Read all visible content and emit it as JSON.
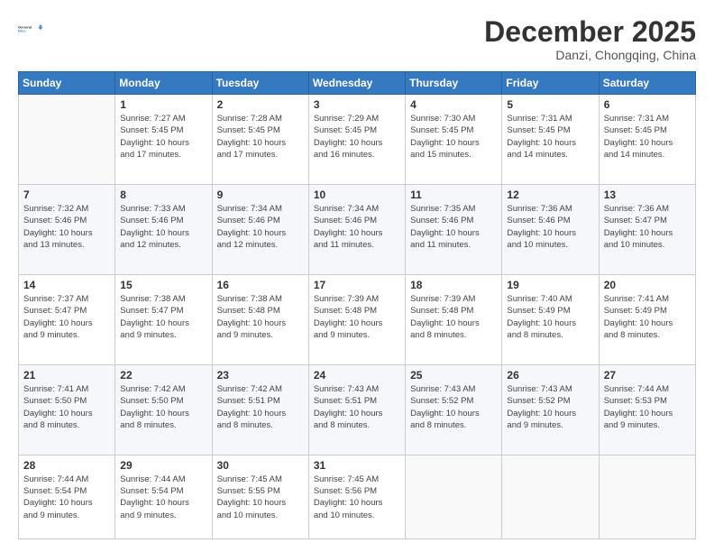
{
  "header": {
    "logo": {
      "line1": "General",
      "line2": "Blue"
    },
    "title": "December 2025",
    "subtitle": "Danzi, Chongqing, China"
  },
  "weekdays": [
    "Sunday",
    "Monday",
    "Tuesday",
    "Wednesday",
    "Thursday",
    "Friday",
    "Saturday"
  ],
  "weeks": [
    [
      {
        "day": "",
        "info": ""
      },
      {
        "day": "1",
        "info": "Sunrise: 7:27 AM\nSunset: 5:45 PM\nDaylight: 10 hours\nand 17 minutes."
      },
      {
        "day": "2",
        "info": "Sunrise: 7:28 AM\nSunset: 5:45 PM\nDaylight: 10 hours\nand 17 minutes."
      },
      {
        "day": "3",
        "info": "Sunrise: 7:29 AM\nSunset: 5:45 PM\nDaylight: 10 hours\nand 16 minutes."
      },
      {
        "day": "4",
        "info": "Sunrise: 7:30 AM\nSunset: 5:45 PM\nDaylight: 10 hours\nand 15 minutes."
      },
      {
        "day": "5",
        "info": "Sunrise: 7:31 AM\nSunset: 5:45 PM\nDaylight: 10 hours\nand 14 minutes."
      },
      {
        "day": "6",
        "info": "Sunrise: 7:31 AM\nSunset: 5:45 PM\nDaylight: 10 hours\nand 14 minutes."
      }
    ],
    [
      {
        "day": "7",
        "info": "Sunrise: 7:32 AM\nSunset: 5:46 PM\nDaylight: 10 hours\nand 13 minutes."
      },
      {
        "day": "8",
        "info": "Sunrise: 7:33 AM\nSunset: 5:46 PM\nDaylight: 10 hours\nand 12 minutes."
      },
      {
        "day": "9",
        "info": "Sunrise: 7:34 AM\nSunset: 5:46 PM\nDaylight: 10 hours\nand 12 minutes."
      },
      {
        "day": "10",
        "info": "Sunrise: 7:34 AM\nSunset: 5:46 PM\nDaylight: 10 hours\nand 11 minutes."
      },
      {
        "day": "11",
        "info": "Sunrise: 7:35 AM\nSunset: 5:46 PM\nDaylight: 10 hours\nand 11 minutes."
      },
      {
        "day": "12",
        "info": "Sunrise: 7:36 AM\nSunset: 5:46 PM\nDaylight: 10 hours\nand 10 minutes."
      },
      {
        "day": "13",
        "info": "Sunrise: 7:36 AM\nSunset: 5:47 PM\nDaylight: 10 hours\nand 10 minutes."
      }
    ],
    [
      {
        "day": "14",
        "info": "Sunrise: 7:37 AM\nSunset: 5:47 PM\nDaylight: 10 hours\nand 9 minutes."
      },
      {
        "day": "15",
        "info": "Sunrise: 7:38 AM\nSunset: 5:47 PM\nDaylight: 10 hours\nand 9 minutes."
      },
      {
        "day": "16",
        "info": "Sunrise: 7:38 AM\nSunset: 5:48 PM\nDaylight: 10 hours\nand 9 minutes."
      },
      {
        "day": "17",
        "info": "Sunrise: 7:39 AM\nSunset: 5:48 PM\nDaylight: 10 hours\nand 9 minutes."
      },
      {
        "day": "18",
        "info": "Sunrise: 7:39 AM\nSunset: 5:48 PM\nDaylight: 10 hours\nand 8 minutes."
      },
      {
        "day": "19",
        "info": "Sunrise: 7:40 AM\nSunset: 5:49 PM\nDaylight: 10 hours\nand 8 minutes."
      },
      {
        "day": "20",
        "info": "Sunrise: 7:41 AM\nSunset: 5:49 PM\nDaylight: 10 hours\nand 8 minutes."
      }
    ],
    [
      {
        "day": "21",
        "info": "Sunrise: 7:41 AM\nSunset: 5:50 PM\nDaylight: 10 hours\nand 8 minutes."
      },
      {
        "day": "22",
        "info": "Sunrise: 7:42 AM\nSunset: 5:50 PM\nDaylight: 10 hours\nand 8 minutes."
      },
      {
        "day": "23",
        "info": "Sunrise: 7:42 AM\nSunset: 5:51 PM\nDaylight: 10 hours\nand 8 minutes."
      },
      {
        "day": "24",
        "info": "Sunrise: 7:43 AM\nSunset: 5:51 PM\nDaylight: 10 hours\nand 8 minutes."
      },
      {
        "day": "25",
        "info": "Sunrise: 7:43 AM\nSunset: 5:52 PM\nDaylight: 10 hours\nand 8 minutes."
      },
      {
        "day": "26",
        "info": "Sunrise: 7:43 AM\nSunset: 5:52 PM\nDaylight: 10 hours\nand 9 minutes."
      },
      {
        "day": "27",
        "info": "Sunrise: 7:44 AM\nSunset: 5:53 PM\nDaylight: 10 hours\nand 9 minutes."
      }
    ],
    [
      {
        "day": "28",
        "info": "Sunrise: 7:44 AM\nSunset: 5:54 PM\nDaylight: 10 hours\nand 9 minutes."
      },
      {
        "day": "29",
        "info": "Sunrise: 7:44 AM\nSunset: 5:54 PM\nDaylight: 10 hours\nand 9 minutes."
      },
      {
        "day": "30",
        "info": "Sunrise: 7:45 AM\nSunset: 5:55 PM\nDaylight: 10 hours\nand 10 minutes."
      },
      {
        "day": "31",
        "info": "Sunrise: 7:45 AM\nSunset: 5:56 PM\nDaylight: 10 hours\nand 10 minutes."
      },
      {
        "day": "",
        "info": ""
      },
      {
        "day": "",
        "info": ""
      },
      {
        "day": "",
        "info": ""
      }
    ]
  ]
}
